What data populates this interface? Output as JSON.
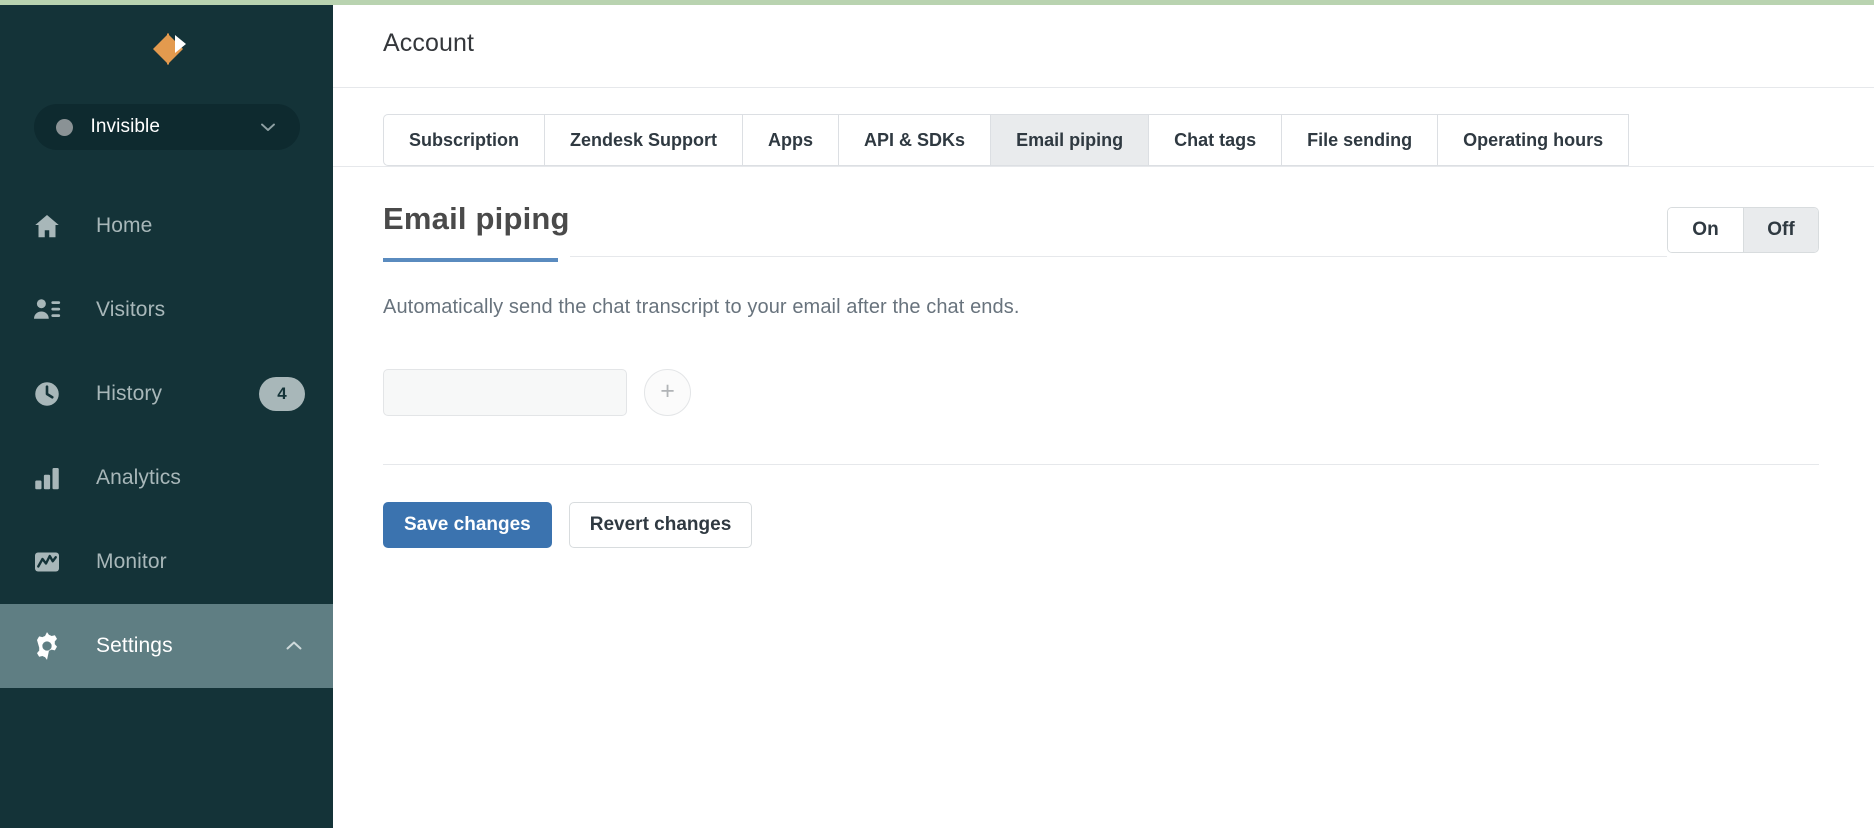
{
  "theme": {
    "sidebar_bg": "#143338",
    "sidebar_active_bg": "#5f7e83",
    "top_strip": "#b9d3b0",
    "primary_button": "#3b73af",
    "title_underline": "#5a8bbf",
    "logo_orange": "#e39a4e",
    "logo_white": "#ffffff"
  },
  "sidebar": {
    "logo_name": "zendesk-chat-logo",
    "status": {
      "label": "Invisible",
      "dot_color": "#8a9295",
      "caret_icon": "chevron-down-icon"
    },
    "items": [
      {
        "label": "Home",
        "icon": "home-icon",
        "badge": "",
        "active": false,
        "caret": ""
      },
      {
        "label": "Visitors",
        "icon": "visitors-icon",
        "badge": "",
        "active": false,
        "caret": ""
      },
      {
        "label": "History",
        "icon": "clock-icon",
        "badge": "4",
        "active": false,
        "caret": ""
      },
      {
        "label": "Analytics",
        "icon": "bar-chart-icon",
        "badge": "",
        "active": false,
        "caret": ""
      },
      {
        "label": "Monitor",
        "icon": "monitor-icon",
        "badge": "",
        "active": false,
        "caret": ""
      },
      {
        "label": "Settings",
        "icon": "gear-icon",
        "badge": "",
        "active": true,
        "caret": "chevron-up-icon"
      }
    ]
  },
  "header": {
    "title": "Account"
  },
  "tabs": [
    {
      "label": "Subscription",
      "active": false
    },
    {
      "label": "Zendesk Support",
      "active": false
    },
    {
      "label": "Apps",
      "active": false
    },
    {
      "label": "API & SDKs",
      "active": false
    },
    {
      "label": "Email piping",
      "active": true
    },
    {
      "label": "Chat tags",
      "active": false
    },
    {
      "label": "File sending",
      "active": false
    },
    {
      "label": "Operating hours",
      "active": false
    }
  ],
  "section": {
    "title": "Email piping",
    "description": "Automatically send the chat transcript to your email after the chat ends.",
    "toggle": {
      "on_label": "On",
      "off_label": "Off",
      "selected": "Off"
    },
    "email_field": {
      "value": "",
      "placeholder": ""
    },
    "add_button_label": "+"
  },
  "actions": {
    "save_label": "Save changes",
    "revert_label": "Revert changes"
  }
}
